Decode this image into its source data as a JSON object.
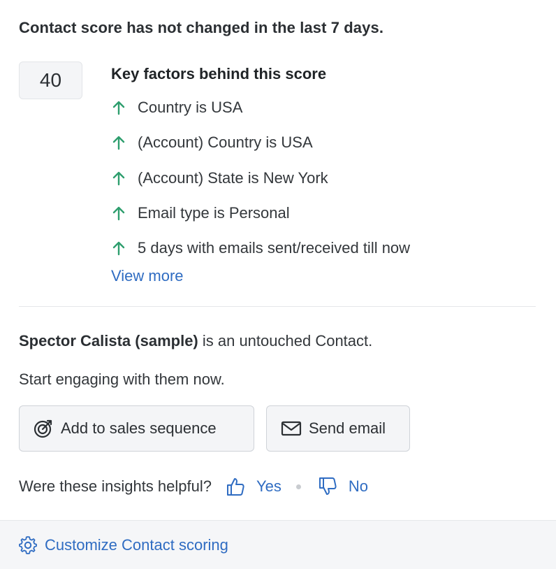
{
  "headline": "Contact score has not changed in the last 7 days.",
  "score": "40",
  "factors": {
    "title": "Key factors behind this score",
    "items": [
      {
        "label": "Country is USA",
        "direction": "up",
        "icon": "arrow-up-icon"
      },
      {
        "label": "(Account) Country is USA",
        "direction": "up",
        "icon": "arrow-up-icon"
      },
      {
        "label": "(Account) State is New York",
        "direction": "up",
        "icon": "arrow-up-icon"
      },
      {
        "label": "Email type is Personal",
        "direction": "up",
        "icon": "arrow-up-icon"
      },
      {
        "label": "5 days with emails sent/received till now",
        "direction": "up",
        "icon": "arrow-up-icon"
      }
    ],
    "view_more": "View more"
  },
  "status": {
    "contact_name": "Spector Calista (sample)",
    "status_text": " is an untouched Contact.",
    "prompt": "Start engaging with them now."
  },
  "actions": {
    "sequence_label": "Add to sales sequence",
    "sequence_icon": "target-icon",
    "email_label": "Send email",
    "email_icon": "envelope-icon"
  },
  "feedback": {
    "question": "Were these insights helpful?",
    "yes": "Yes",
    "no": "No"
  },
  "footer": {
    "link": "Customize Contact scoring",
    "icon": "gear-icon"
  },
  "colors": {
    "accent": "#2f6cc2",
    "positive": "#2e9e6e",
    "text": "#2b2f33"
  }
}
